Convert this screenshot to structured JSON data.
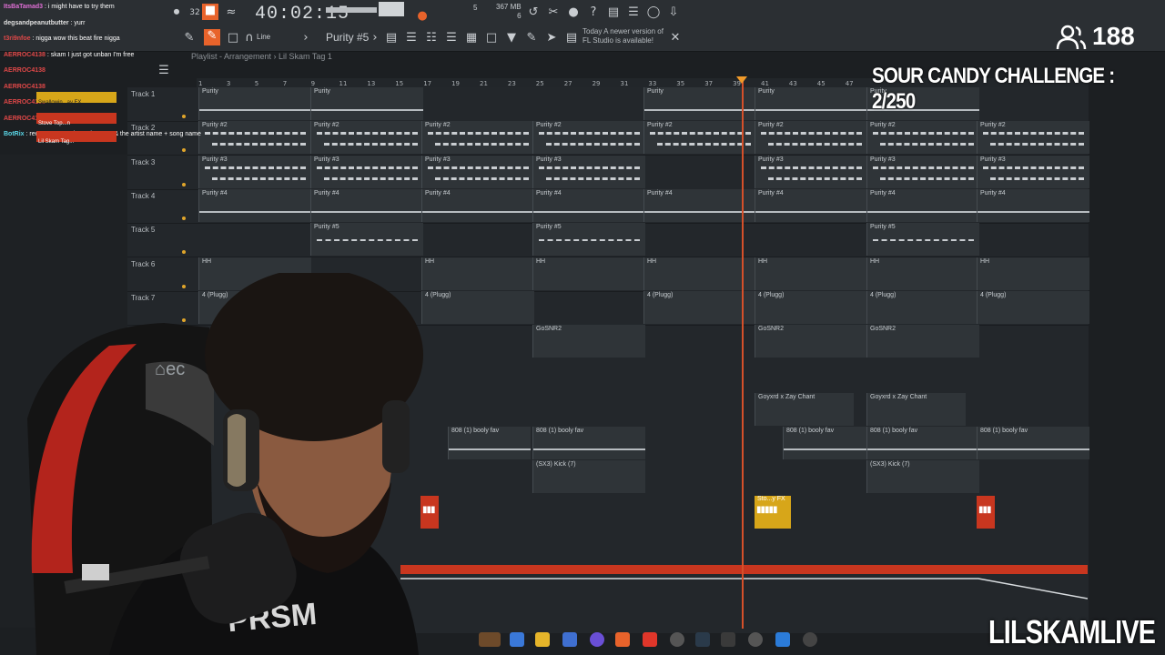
{
  "toolbar": {
    "time": "40:02:15",
    "pattern": "Purity #5",
    "line_mode": "Line",
    "memory": "367 MB",
    "memory_sub": "6",
    "pattern_num": "5",
    "news_line1": "Today  A newer version of",
    "news_line2": "FL Studio is available!"
  },
  "playlist": {
    "title": "Playlist - Arrangement › Lil Skam Tag 1",
    "ticks": [
      "1",
      "3",
      "5",
      "7",
      "9",
      "11",
      "13",
      "15",
      "17",
      "19",
      "21",
      "23",
      "25",
      "27",
      "29",
      "31",
      "33",
      "35",
      "37",
      "39",
      "41",
      "43",
      "45",
      "47"
    ]
  },
  "tracks": [
    {
      "label": "Track 1"
    },
    {
      "label": "Track 2"
    },
    {
      "label": "Track 3"
    },
    {
      "label": "Track 4"
    },
    {
      "label": "Track 5"
    },
    {
      "label": "Track 6"
    },
    {
      "label": "Track 7"
    }
  ],
  "clips": {
    "purity": "Purity",
    "purity2": "Purity #2",
    "purity3": "Purity #3",
    "purity4": "Purity #4",
    "purity5": "Purity #5",
    "hh": "HH",
    "plugg": "4 (Plugg)",
    "gosnr": "GoSNR2",
    "goyxrd": "Goyxrd x Zay Chant",
    "bass": "808 (1) booly fav",
    "kick": "(SX3) Kick (7)",
    "fx": "Sto...y FX"
  },
  "chat": [
    {
      "user": "ItsBaTamad3",
      "msg": "i might have to try them",
      "color": "#e06fd6"
    },
    {
      "user": "degsandpeanutbutter",
      "msg": "yurr",
      "color": "#e0e0e0"
    },
    {
      "user": "t3ri9nfoe",
      "msg": "nigga wow this beat fire nigga",
      "color": "#e04848"
    },
    {
      "user": "AERROC4138",
      "msg": "skam I just got unban I'm free",
      "color": "#e04848"
    },
    {
      "user": "AERROC4138",
      "msg": "",
      "color": "#e04848"
    },
    {
      "user": "AERROC4138",
      "msg": "",
      "color": "#e04848"
    },
    {
      "user": "AERROC4138",
      "msg": "",
      "color": "#e04848"
    },
    {
      "user": "AERROC4138",
      "msg": "",
      "color": "#e04848"
    },
    {
      "user": "BotRix",
      "msg": "request a song by typing \"!sr\" & the artist name + song name",
      "color": "#5ad7e8"
    }
  ],
  "chat_overlay": {
    "item1": "Swallowin...ay FX",
    "item2": "Stove Top...n",
    "item3": "Lil Skam Tag..."
  },
  "stream": {
    "viewer_count": "188",
    "challenge": "SOUR CANDY CHALLENGE : 2/250",
    "watermark": "LILSKAMLIVE"
  },
  "colors": {
    "accent_orange": "#f09a2a",
    "playhead": "#d5502a",
    "fx_red": "#c8361f",
    "fx_yellow": "#d7a619"
  }
}
